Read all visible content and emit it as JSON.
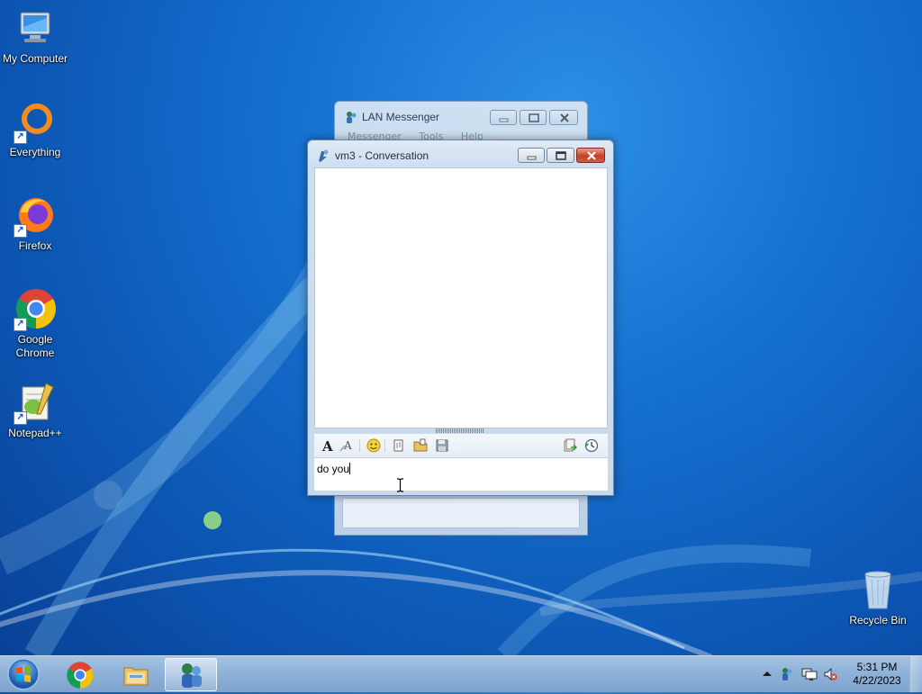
{
  "desktop": {
    "icons": [
      {
        "label": "My Computer",
        "icon": "computer-icon"
      },
      {
        "label": "Everything",
        "icon": "everything-icon"
      },
      {
        "label": "Firefox",
        "icon": "firefox-icon"
      },
      {
        "label": "Google Chrome",
        "icon": "chrome-icon"
      },
      {
        "label": "Notepad++",
        "icon": "notepadpp-icon"
      },
      {
        "label": "Recycle Bin",
        "icon": "recycle-bin-icon"
      }
    ]
  },
  "main_window": {
    "title": "LAN Messenger",
    "menu": [
      "Messenger",
      "Tools",
      "Help"
    ]
  },
  "conversation_window": {
    "title": "vm3 - Conversation",
    "input_value": "do you",
    "toolbar": [
      "font-icon",
      "font-color-icon",
      "smiley-icon",
      "send-file-icon",
      "send-folder-icon",
      "save-icon",
      "history-export-icon",
      "history-icon"
    ]
  },
  "taskbar": {
    "pinned": [
      "chrome-icon",
      "explorer-icon",
      "lan-messenger-icon"
    ],
    "tray": [
      "show-hidden-icons",
      "lan-messenger-tray-icon",
      "network-icon",
      "volume-muted-icon"
    ],
    "time": "5:31 PM",
    "date": "4/22/2023"
  },
  "colors": {
    "accent": "#1570cf",
    "close_button": "#c83e26"
  }
}
